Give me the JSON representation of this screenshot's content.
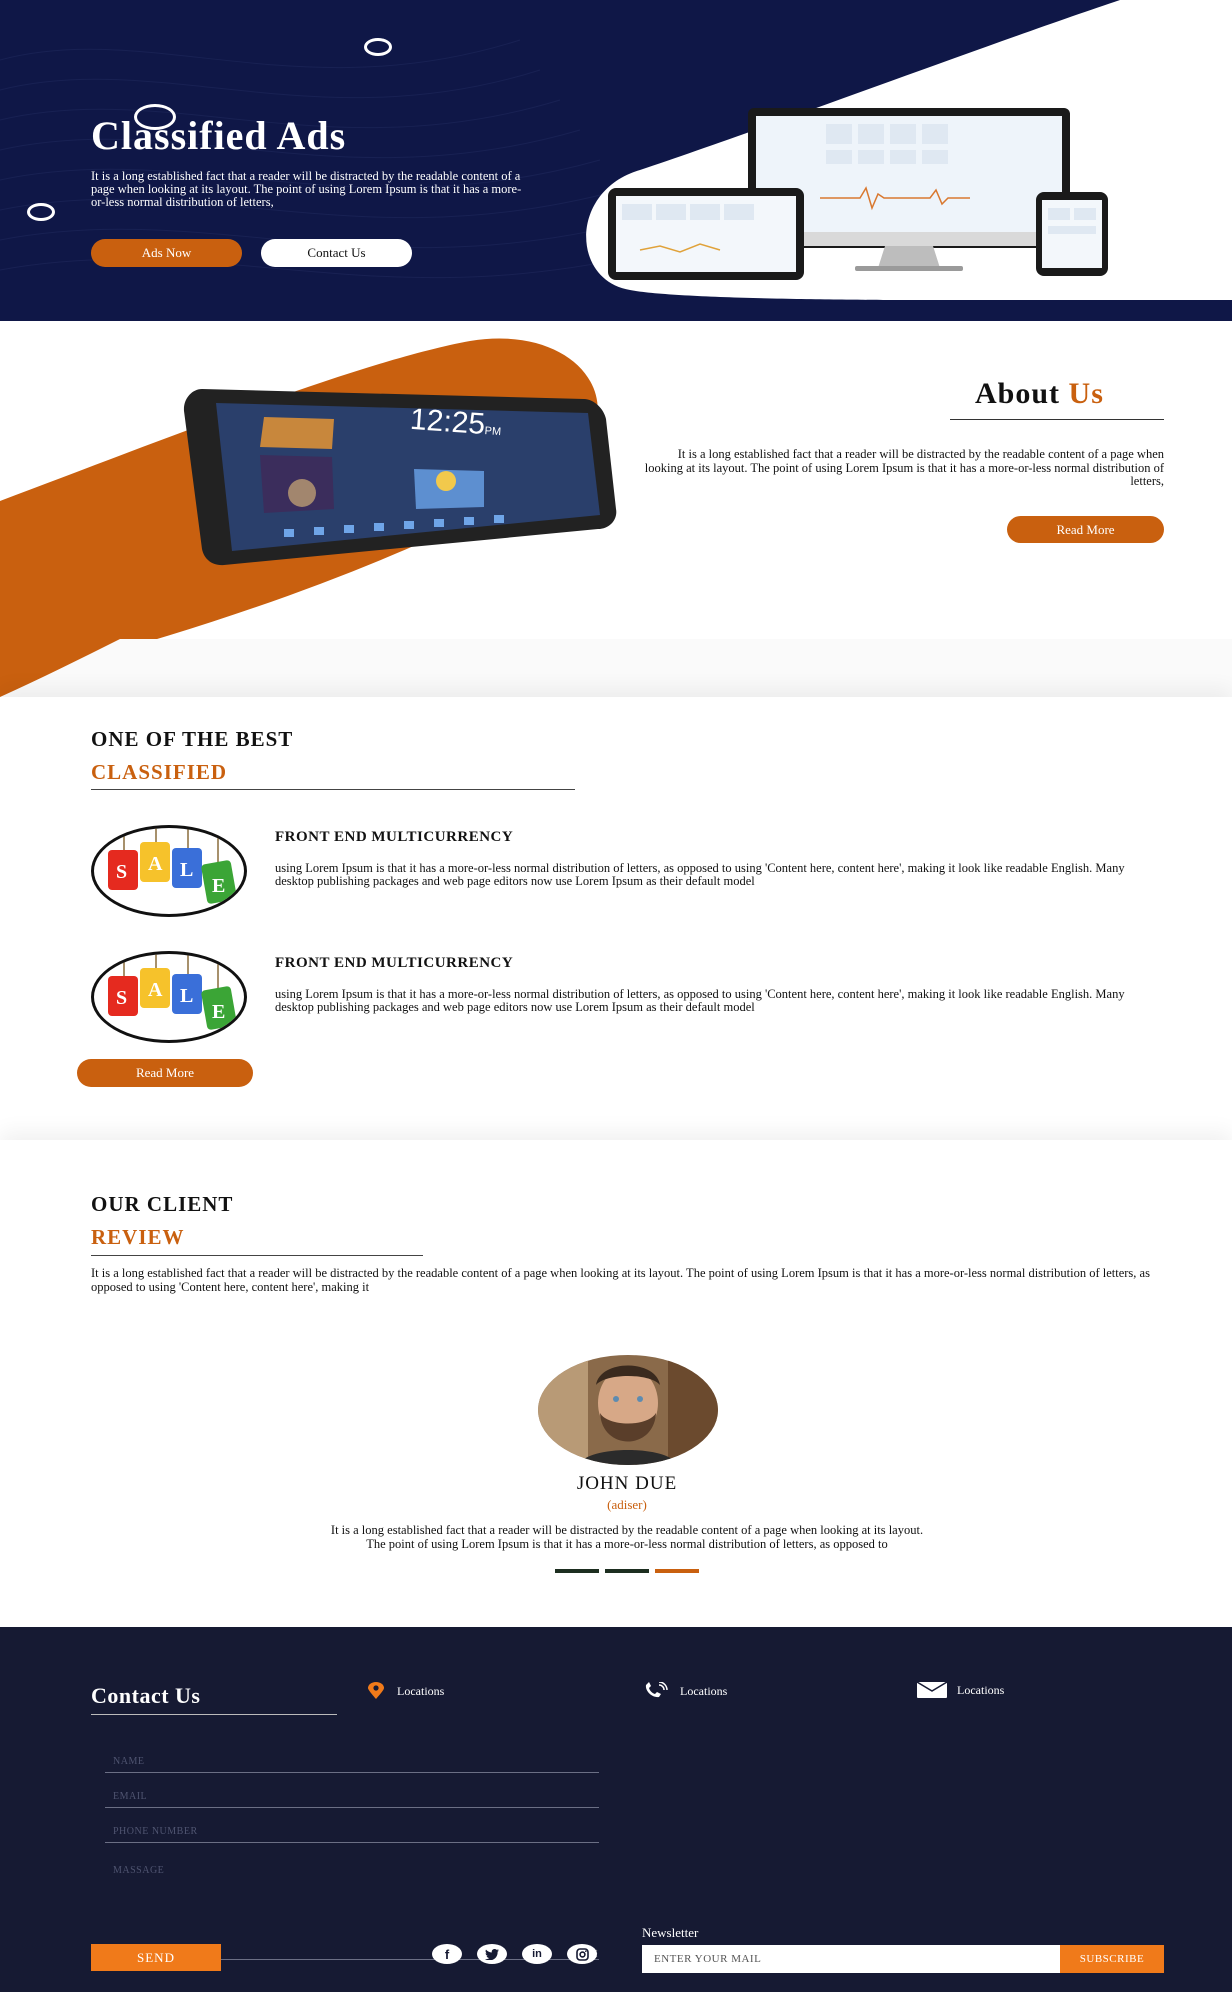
{
  "colors": {
    "navy": "#0f1747",
    "orange": "#c9600f",
    "footer": "#161a33",
    "bright_orange": "#f07a1a"
  },
  "hero": {
    "title": "Classified Ads",
    "text": "It is a long established fact that a reader will be distracted by the readable content of a page when looking at its layout. The point of using Lorem Ipsum is that it has a more-or-less normal distribution of letters,",
    "ads_button": "Ads Now",
    "contact_button": "Contact Us"
  },
  "about": {
    "title_main": "About",
    "title_accent": "Us",
    "text": "It is a long established fact that a reader will be distracted by the readable content of a page when looking at its layout. The point of using Lorem Ipsum is that it has a more-or-less normal distribution of letters,",
    "read_more": "Read More",
    "tablet_time": "12:25",
    "tablet_ampm": "PM"
  },
  "best": {
    "heading_line1": "ONE OF THE BEST",
    "heading_line2": "CLASSIFIED",
    "badge_letters": [
      "S",
      "A",
      "L",
      "E"
    ],
    "features": [
      {
        "title": "FRONT END MULTICURRENCY",
        "text": "using Lorem Ipsum is that it has a more-or-less normal distribution of letters, as opposed to using 'Content here, content here', making it look like readable English. Many desktop publishing packages and web page editors now use Lorem Ipsum as their default model"
      },
      {
        "title": "FRONT END MULTICURRENCY",
        "text": "using Lorem Ipsum is that it has a more-or-less normal distribution of letters, as opposed to using 'Content here, content here', making it look like readable English. Many desktop publishing packages and web page editors now use Lorem Ipsum as their default model"
      }
    ],
    "read_more": "Read More"
  },
  "review": {
    "heading_line1": "OUR CLIENT",
    "heading_line2": "REVIEW",
    "intro": "It is a long established fact that a reader will be distracted by the readable content of a page when looking at its layout. The point of using Lorem Ipsum is that it has a more-or-less normal distribution of letters, as opposed to using 'Content here, content here', making it",
    "client_name": "JOHN DUE",
    "client_role": "(adiser)",
    "quote_line1": "It is a long established fact that a reader will be distracted by the readable content of a page when looking at its layout.",
    "quote_line2": "The point of using Lorem Ipsum is that it has a more-or-less normal distribution of letters, as opposed to"
  },
  "footer": {
    "title": "Contact Us",
    "locations": [
      "Locations",
      "Locations",
      "Locations"
    ],
    "fields": {
      "name": "NAME",
      "email": "EMAIL",
      "phone": "PHONE NUMBER",
      "message": "MASSAGE"
    },
    "send": "SEND",
    "newsletter_label": "Newsletter",
    "mail_placeholder": "ENTER YOUR MAIL",
    "subscribe": "SUBSCRIBE",
    "social": [
      "facebook-icon",
      "twitter-icon",
      "linkedin-icon",
      "instagram-icon"
    ]
  }
}
